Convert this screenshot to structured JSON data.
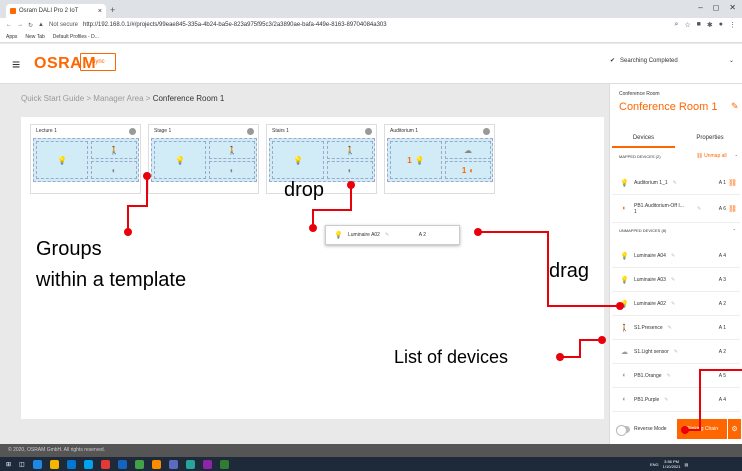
{
  "browser": {
    "tab_title": "Osram DALI Pro 2 IoT",
    "new_tab_symbol": "+",
    "url_secure_label": "Not secure",
    "url": "http://192.168.0.1/#/projects/99eae845-335a-4b24-ba5e-823a975f95c3/2a3890ae-bafa-449e-8163-89704084a303",
    "bookmarks": [
      "Apps",
      "New Tab",
      "Default Profiles - D..."
    ]
  },
  "header": {
    "logo": "OSRAM",
    "sync_label": "Sync",
    "status": "Searching Completed"
  },
  "breadcrumb": {
    "parts": [
      "Quick Start Guide",
      "Manager Area"
    ],
    "separator": ">",
    "current": "Conference Room 1"
  },
  "groups": [
    {
      "title": "Lecture 1",
      "count": ""
    },
    {
      "title": "Stage 1",
      "count": ""
    },
    {
      "title": "Stairs 1",
      "count": ""
    },
    {
      "title": "Auditorium 1",
      "count": "1",
      "count2": "1"
    }
  ],
  "floating_device": {
    "name": "Luminaire A02",
    "address": "A 2"
  },
  "annotations": {
    "drop": "drop",
    "groups_line1": "Groups",
    "groups_line2": "within a template",
    "drag": "drag",
    "list": "List of devices"
  },
  "panel": {
    "room_label": "Conference Room",
    "room_name": "Conference Room 1",
    "tab_devices": "Devices",
    "tab_properties": "Properties",
    "mapped_header": "MAPPED DEVICES (2)",
    "unmap_all": "Unmap all",
    "unmapped_header": "UNMAPPED DEVICES (8)",
    "mapped": [
      {
        "name": "Auditorium 1_1",
        "address": "A 1",
        "icon": "bulb-on"
      },
      {
        "name": "PB1.Auditorium-Off I...\n1",
        "address": "A 6",
        "icon": "switch-on"
      }
    ],
    "unmapped": [
      {
        "name": "Luminaire A04",
        "address": "A 4",
        "icon": "bulb"
      },
      {
        "name": "Luminaire A03",
        "address": "A 3",
        "icon": "bulb"
      },
      {
        "name": "Luminaire A02",
        "address": "A 2",
        "icon": "bulb"
      },
      {
        "name": "S1.Presence",
        "address": "A 1",
        "icon": "presence"
      },
      {
        "name": "S1.Light sensor",
        "address": "A 2",
        "icon": "light-sensor"
      },
      {
        "name": "PB1.Orange",
        "address": "A 5",
        "icon": "switch"
      },
      {
        "name": "PB1.Purple",
        "address": "A 4",
        "icon": "switch"
      }
    ],
    "reverse_mode": "Reverse Mode",
    "blinking_chain": "Blinking Chain"
  },
  "footer": {
    "copyright": "© 2020, OSRAM GmbH. All rights reserved."
  },
  "taskbar": {
    "time": "3:56 PM",
    "date": "1/10/2021",
    "lang": "ENG"
  },
  "colors": {
    "accent": "#ff6600",
    "annotation": "#e8000b",
    "drop_zone": "#d2ecf7"
  }
}
